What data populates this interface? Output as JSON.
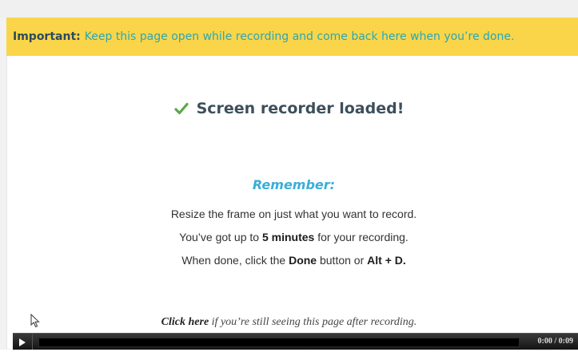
{
  "banner": {
    "lead": "Important:",
    "message": "Keep this page open while recording and come back here when you’re done."
  },
  "status": {
    "icon": "checkmark-icon",
    "text": "Screen recorder loaded!"
  },
  "remember": {
    "heading": "Remember:",
    "line1": "Resize the frame on just what you want to record.",
    "line2_pre": "You’ve got up to ",
    "line2_bold": "5 minutes",
    "line2_post": " for your recording.",
    "line3_pre": "When done, click the ",
    "line3_bold1": "Done",
    "line3_mid": " button or ",
    "line3_bold2": "Alt + D."
  },
  "footer": {
    "link": "Click here",
    "rest": " if you’re still seeing this page after recording."
  },
  "player": {
    "time": "0:00 / 0:09",
    "progress": 0
  },
  "colors": {
    "banner_bg": "#fad54a",
    "accent_teal": "#2aa7b3",
    "accent_blue": "#3aaed8",
    "check_green": "#5aa84a"
  }
}
